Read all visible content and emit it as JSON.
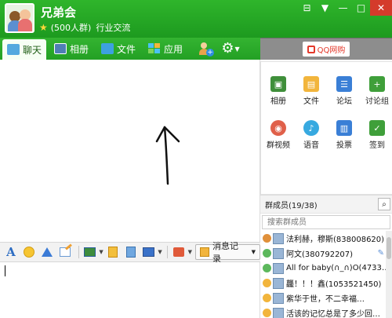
{
  "header": {
    "group_name": "兄弟会",
    "member_count": "(500人群)",
    "category": "行业交流",
    "window_controls": [
      "pin-icon",
      "dropdown-icon",
      "minimize-icon",
      "maximize-icon",
      "close-icon"
    ]
  },
  "tabs": [
    {
      "label": "聊天",
      "icon": "chat-icon",
      "active": true
    },
    {
      "label": "相册",
      "icon": "album-icon",
      "active": false
    },
    {
      "label": "文件",
      "icon": "folder-icon",
      "active": false
    },
    {
      "label": "应用",
      "icon": "apps-icon",
      "active": false
    }
  ],
  "ad": {
    "label": "QQ网购"
  },
  "input_toolbar": {
    "font_glyph": "A",
    "history_label": "消息记录"
  },
  "apps": [
    {
      "label": "相册",
      "icon": "album-icon",
      "color": "#3f8f3a"
    },
    {
      "label": "文件",
      "icon": "folder-icon",
      "color": "#f2b53c"
    },
    {
      "label": "论坛",
      "icon": "forum-icon",
      "color": "#3a7fd6"
    },
    {
      "label": "讨论组",
      "icon": "discussion-icon",
      "color": "#3f9f3a"
    },
    {
      "label": "群视频",
      "icon": "video-icon",
      "color": "#e0604a"
    },
    {
      "label": "语音",
      "icon": "voice-icon",
      "color": "#37a9e0"
    },
    {
      "label": "投票",
      "icon": "vote-icon",
      "color": "#3a7fd6"
    },
    {
      "label": "签到",
      "icon": "checkin-icon",
      "color": "#3f9f3a"
    }
  ],
  "members": {
    "header": "群成员(19/38)",
    "search_placeholder": "搜索群成员",
    "list": [
      {
        "name": "法利赫，穆斯(838008620)",
        "badge": "owner-icon",
        "color": "#e0903a"
      },
      {
        "name": "阿文(380792207)",
        "badge": "online-icon",
        "color": "#5cb85c"
      },
      {
        "name": "All for baby(∩_∩)O(4733…",
        "badge": "online-icon",
        "color": "#5cb85c"
      },
      {
        "name": "龘！！！鑫(1053521450)",
        "badge": "admin-icon",
        "color": "#f2b53c"
      },
      {
        "name": "紫华于世，不二幸福…",
        "badge": "admin-icon",
        "color": "#f2b53c"
      },
      {
        "name": "活该的记忆总是了多少回…",
        "badge": "admin-icon",
        "color": "#f2b53c"
      }
    ]
  }
}
